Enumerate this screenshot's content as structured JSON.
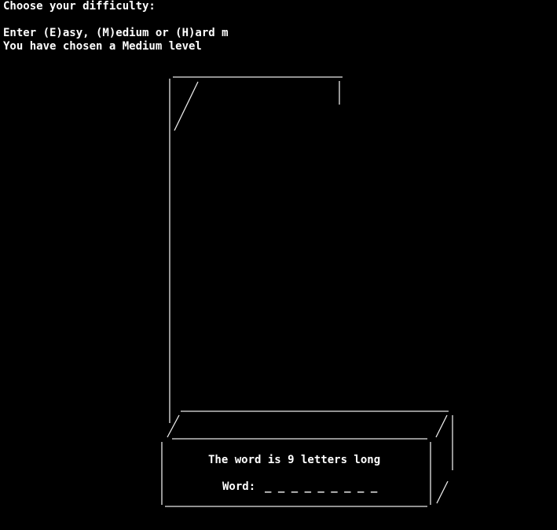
{
  "terminal": {
    "prompt_heading": "Choose your difficulty:",
    "options_line": "Enter (E)asy, (M)edium or (H)ard m",
    "confirmation_line": "You have chosen a Medium level"
  },
  "game_panel": {
    "word_length_text": "The word is 9 letters long",
    "word_label": "Word:",
    "word_blanks": "_ _ _ _ _ _ _ _ _"
  },
  "colors": {
    "background": "#000000",
    "text": "#ffffff",
    "ascii_lines": "#e8e8e8"
  }
}
